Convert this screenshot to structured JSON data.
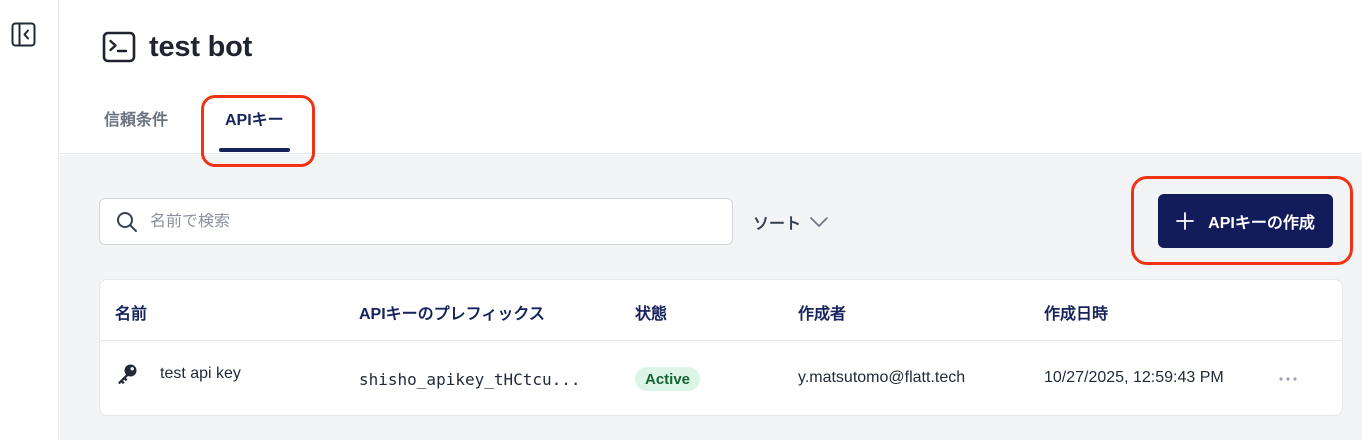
{
  "page": {
    "title": "test bot"
  },
  "tabs": [
    {
      "label": "信頼条件",
      "active": false
    },
    {
      "label": "APIキー",
      "active": true
    }
  ],
  "toolbar": {
    "search_placeholder": "名前で検索",
    "sort_label": "ソート",
    "create_button_label": "APIキーの作成"
  },
  "table": {
    "columns": [
      "名前",
      "APIキーのプレフィックス",
      "状態",
      "作成者",
      "作成日時"
    ],
    "rows": [
      {
        "name": "test api key",
        "prefix": "shisho_apikey_tHCtcu...",
        "status": "Active",
        "created_by": "y.matsutomo@flatt.tech",
        "created_at": "10/27/2025, 12:59:43 PM",
        "icon": "key-icon"
      }
    ]
  },
  "colors": {
    "accent": "#131c5b",
    "highlight": "#ef3314",
    "status_active_bg": "#dcf5e6",
    "status_active_text": "#166534"
  }
}
